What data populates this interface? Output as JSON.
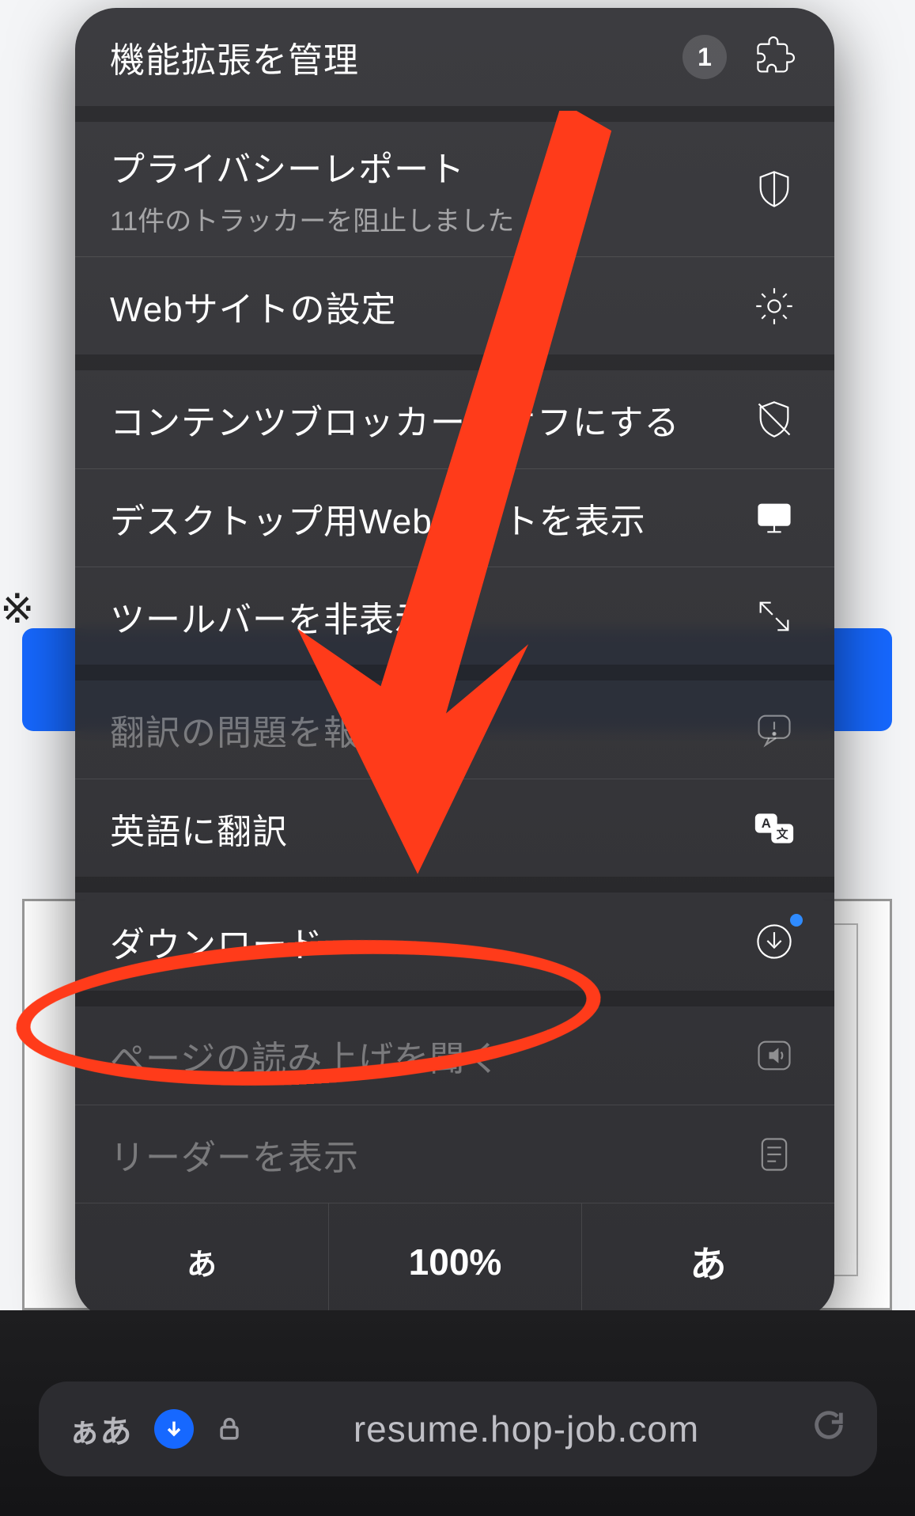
{
  "bg": {
    "note_prefix": "※"
  },
  "menu": {
    "manage_extensions": {
      "label": "機能拡張を管理",
      "badge": "1"
    },
    "privacy_report": {
      "label": "プライバシーレポート",
      "sub": "11件のトラッカーを阻止しました"
    },
    "website_settings": {
      "label": "Webサイトの設定"
    },
    "content_blockers_off": {
      "label": "コンテンツブロッカーをオフにする"
    },
    "request_desktop": {
      "label": "デスクトップ用Webサイトを表示"
    },
    "hide_toolbar": {
      "label": "ツールバーを非表示"
    },
    "report_translation": {
      "label": "翻訳の問題を報告"
    },
    "translate_en": {
      "label": "英語に翻訳"
    },
    "downloads": {
      "label": "ダウンロード"
    },
    "listen_page": {
      "label": "ページの読み上げを聞く"
    },
    "show_reader": {
      "label": "リーダーを表示"
    },
    "footer": {
      "small_a": "あ",
      "zoom": "100%",
      "big_a": "あ"
    }
  },
  "urlbar": {
    "aa": "ぁあ",
    "host": "resume.hop-job.com"
  }
}
